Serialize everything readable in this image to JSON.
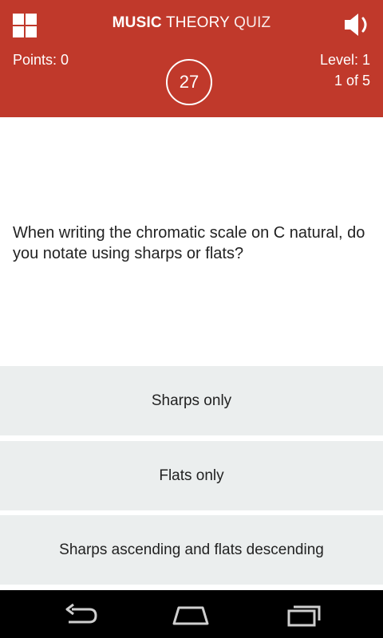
{
  "app": {
    "title_bold": "MUSIC",
    "title_mid": "THEORY",
    "title_end": "QUIZ"
  },
  "header": {
    "points": "Points: 0",
    "level": "Level: 1",
    "progress": "1 of 5",
    "timer": "27",
    "background_color": "#c0392b"
  },
  "icons": {
    "menu": "grid-menu-icon",
    "sound": "speaker-icon",
    "back": "back-icon",
    "home": "home-icon",
    "recent": "recent-apps-icon"
  },
  "question": {
    "text": "When writing the chromatic scale on C natural, do you notate using sharps or flats?"
  },
  "answers": [
    {
      "label": "Sharps only"
    },
    {
      "label": "Flats only"
    },
    {
      "label": "Sharps ascending and flats descending"
    }
  ]
}
